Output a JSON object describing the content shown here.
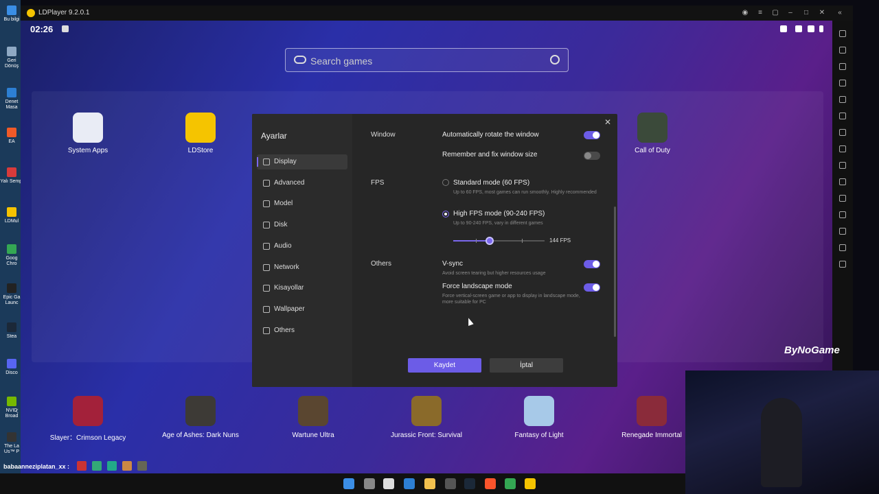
{
  "desktop": {
    "icons": [
      {
        "label": "Bu bilgi",
        "color": "#3a8ee6"
      },
      {
        "label": "Geri Dönüş",
        "color": "#8fa9c4"
      },
      {
        "label": "Denet Masa",
        "color": "#2d7fd3"
      },
      {
        "label": "EA",
        "color": "#f05a28"
      },
      {
        "label": "Yalı Sempi",
        "color": "#d83b3b"
      },
      {
        "label": "LDMul",
        "color": "#f5c400"
      },
      {
        "label": "Goog Chro",
        "color": "#34a853"
      },
      {
        "label": "Epic Ga Launc",
        "color": "#222222"
      },
      {
        "label": "Stea",
        "color": "#1b2838"
      },
      {
        "label": "Disco",
        "color": "#5865f2"
      },
      {
        "label": "NVID Broad",
        "color": "#76b900"
      },
      {
        "label": "The La Us™ P",
        "color": "#333333"
      }
    ]
  },
  "window": {
    "title": "LDPlayer 9.2.0.1",
    "controls": [
      "account-icon",
      "menu-icon",
      "screen-icon",
      "minimize-icon",
      "maximize-icon",
      "close-icon",
      "collapse-icon"
    ]
  },
  "android": {
    "clock": "02:26",
    "search_placeholder": "Search games"
  },
  "apps_top": [
    {
      "label": "System Apps",
      "color": "#e9ecf5"
    },
    {
      "label": "LDStore",
      "color": "#f5c400"
    },
    {
      "label": "Call of Duty",
      "color": "#3b4a3a"
    }
  ],
  "games_bottom": [
    {
      "label": "Slayer：Crimson Legacy",
      "color": "#a3213a"
    },
    {
      "label": "Age of Ashes: Dark Nuns",
      "color": "#3d3a36"
    },
    {
      "label": "Wartune Ultra",
      "color": "#5a4630"
    },
    {
      "label": "Jurassic Front: Survival",
      "color": "#8a6a2a"
    },
    {
      "label": "Fantasy of Light",
      "color": "#a7c9e8"
    },
    {
      "label": "Renegade Immortal",
      "color": "#8a2b3a"
    }
  ],
  "watermark": "ByNoGame",
  "chat": {
    "username": "babaanneziplatan_xx :"
  },
  "settings": {
    "title": "Ayarlar",
    "nav": [
      {
        "label": "Display",
        "icon": "monitor-icon",
        "active": true
      },
      {
        "label": "Advanced",
        "icon": "advanced-icon",
        "active": false
      },
      {
        "label": "Model",
        "icon": "model-icon",
        "active": false
      },
      {
        "label": "Disk",
        "icon": "disk-icon",
        "active": false
      },
      {
        "label": "Audio",
        "icon": "audio-icon",
        "active": false
      },
      {
        "label": "Network",
        "icon": "globe-icon",
        "active": false
      },
      {
        "label": "Kisayollar",
        "icon": "keyboard-icon",
        "active": false
      },
      {
        "label": "Wallpaper",
        "icon": "palette-icon",
        "active": false
      },
      {
        "label": "Others",
        "icon": "grid-icon",
        "active": false
      }
    ],
    "window_section": {
      "label": "Window",
      "auto_rotate": {
        "label": "Automatically rotate the window",
        "enabled": true
      },
      "remember_size": {
        "label": "Remember and fix window size",
        "enabled": false
      }
    },
    "fps_section": {
      "label": "FPS",
      "standard": {
        "label": "Standard mode (60 FPS)",
        "desc": "Up to 60 FPS, most games can run smoothly. Highly recommended",
        "selected": false
      },
      "high": {
        "label": "High FPS mode (90-240 FPS)",
        "desc": "Up to 90-240 FPS, vary in different games",
        "selected": true
      },
      "slider_value": "144 FPS",
      "slider_fraction": 0.4
    },
    "others_section": {
      "label": "Others",
      "vsync": {
        "label": "V-sync",
        "desc": "Avoid screen tearing but higher resources usage",
        "enabled": true
      },
      "landscape": {
        "label": "Force landscape mode",
        "desc": "Force vertical-screen game or app to display in landscape mode, more suitable for PC",
        "enabled": true
      }
    },
    "save_label": "Kaydet",
    "cancel_label": "İptal"
  }
}
